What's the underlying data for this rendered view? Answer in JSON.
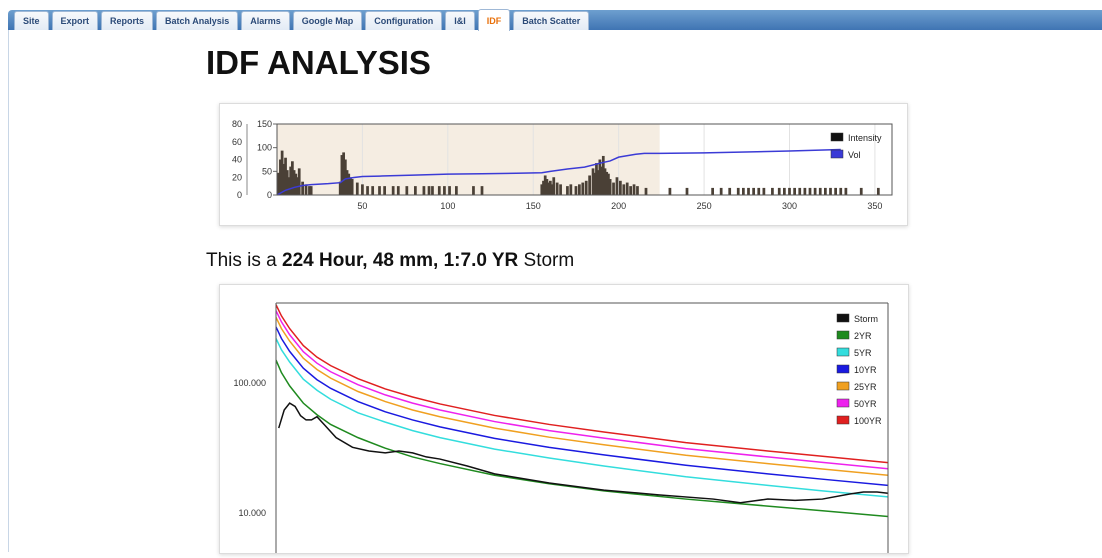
{
  "tabs": [
    {
      "label": "Site"
    },
    {
      "label": "Export"
    },
    {
      "label": "Reports"
    },
    {
      "label": "Batch Analysis"
    },
    {
      "label": "Alarms"
    },
    {
      "label": "Google Map"
    },
    {
      "label": "Configuration"
    },
    {
      "label": "I&I"
    },
    {
      "label": "IDF",
      "active": true
    },
    {
      "label": "Batch Scatter"
    }
  ],
  "page": {
    "title": "IDF ANALYSIS"
  },
  "storm": {
    "prefix": "This is a",
    "summary": "224 Hour, 48 mm, 1:7.0 YR",
    "suffix": "Storm"
  },
  "colors": {
    "tab_active": "#e8700a",
    "header_blue": "#3f74b3",
    "highlight_band": "#f5ede2",
    "bars": "#4a4036",
    "vol": "#3b3bd6"
  },
  "chart_data": [
    {
      "type": "bar",
      "x_ticks": [
        50,
        100,
        150,
        200,
        250,
        300,
        350
      ],
      "xlim": [
        0,
        360
      ],
      "left_axis_ticks": [
        0,
        20,
        40,
        60,
        80
      ],
      "left_ylim": [
        0,
        80
      ],
      "right_axis_ticks": [
        0,
        50,
        100,
        150
      ],
      "right_ylim": [
        0,
        150
      ],
      "highlight_range": [
        0,
        224
      ],
      "series": [
        {
          "name": "Intensity",
          "color": "#111111",
          "x": [
            1,
            2,
            3,
            4,
            5,
            6,
            7,
            8,
            9,
            10,
            11,
            12,
            13,
            15,
            17,
            19,
            20,
            37,
            38,
            39,
            40,
            41,
            42,
            43,
            44,
            47,
            50,
            53,
            56,
            60,
            63,
            68,
            71,
            76,
            81,
            86,
            89,
            91,
            95,
            98,
            101,
            105,
            115,
            120,
            155,
            156,
            157,
            158,
            159,
            160,
            161,
            162,
            164,
            166,
            170,
            172,
            175,
            177,
            179,
            181,
            183,
            185,
            186,
            187,
            188,
            189,
            190,
            191,
            192,
            193,
            194,
            195,
            197,
            199,
            201,
            203,
            205,
            207,
            209,
            211,
            216,
            230,
            240,
            255,
            260,
            265,
            270,
            273,
            276,
            279,
            282,
            285,
            290,
            294,
            297,
            300,
            303,
            306,
            309,
            312,
            315,
            318,
            321,
            324,
            327,
            330,
            333,
            342,
            352
          ],
          "values": [
            25,
            40,
            50,
            35,
            42,
            28,
            20,
            32,
            38,
            28,
            24,
            20,
            30,
            15,
            12,
            10,
            10,
            15,
            45,
            48,
            40,
            28,
            24,
            20,
            18,
            14,
            12,
            10,
            10,
            10,
            10,
            10,
            10,
            10,
            10,
            10,
            10,
            10,
            10,
            10,
            10,
            10,
            10,
            10,
            12,
            16,
            22,
            18,
            14,
            16,
            12,
            20,
            14,
            12,
            10,
            12,
            10,
            12,
            14,
            16,
            22,
            30,
            25,
            36,
            28,
            40,
            32,
            44,
            30,
            26,
            24,
            18,
            14,
            20,
            16,
            12,
            14,
            10,
            12,
            10,
            8,
            8,
            8,
            8,
            8,
            8,
            8,
            8,
            8,
            8,
            8,
            8,
            8,
            8,
            8,
            8,
            8,
            8,
            8,
            8,
            8,
            8,
            8,
            8,
            8,
            8,
            8,
            8,
            8
          ]
        },
        {
          "name": "Vol",
          "color": "#3b3bd6",
          "type": "line",
          "x": [
            0,
            5,
            10,
            15,
            20,
            30,
            37,
            40,
            45,
            50,
            60,
            80,
            100,
            120,
            140,
            155,
            160,
            170,
            180,
            190,
            195,
            200,
            210,
            215,
            224,
            250,
            300,
            330
          ],
          "values": [
            0,
            10,
            16,
            20,
            22,
            24,
            26,
            34,
            37,
            39,
            40,
            42,
            44,
            45,
            46,
            47,
            50,
            55,
            59,
            68,
            72,
            80,
            86,
            88,
            88,
            89,
            93,
            96
          ]
        }
      ]
    },
    {
      "type": "line",
      "yscale": "log",
      "y_ticks": [
        "100.000",
        "10.000"
      ],
      "xlim": [
        0,
        224
      ],
      "series": [
        {
          "name": "Storm",
          "color": "#111111",
          "x": [
            1,
            3,
            5,
            7,
            9,
            11,
            13,
            15,
            18,
            22,
            28,
            34,
            40,
            45,
            50,
            55,
            60,
            70,
            80,
            100,
            120,
            140,
            160,
            170,
            175,
            180,
            190,
            200,
            210,
            215,
            220,
            224
          ],
          "values": [
            45,
            62,
            70,
            66,
            56,
            52,
            52,
            55,
            47,
            38,
            32,
            30,
            29,
            30,
            29,
            27,
            26,
            23,
            20,
            17,
            15,
            13.8,
            12.8,
            12,
            12.4,
            12.8,
            12.5,
            12.8,
            14,
            14.5,
            14.5,
            14.2
          ]
        },
        {
          "name": "2YR",
          "color": "#1f8a1f",
          "x": [
            0,
            2,
            5,
            10,
            15,
            20,
            30,
            40,
            50,
            60,
            80,
            100,
            120,
            150,
            180,
            200,
            224
          ],
          "values": [
            150,
            120,
            95,
            70,
            57,
            48,
            38,
            31.5,
            27,
            24,
            19.5,
            16.8,
            14.8,
            12.8,
            11.3,
            10.4,
            9.4
          ]
        },
        {
          "name": "5YR",
          "color": "#33dddd",
          "x": [
            0,
            2,
            5,
            10,
            15,
            20,
            30,
            40,
            50,
            60,
            80,
            100,
            120,
            150,
            180,
            200,
            224
          ],
          "values": [
            220,
            180,
            145,
            107,
            88,
            75,
            59,
            50,
            43,
            38,
            31,
            26.5,
            23,
            19,
            16.3,
            14.8,
            13.3
          ]
        },
        {
          "name": "10YR",
          "color": "#1a1ae0",
          "x": [
            0,
            2,
            5,
            10,
            15,
            20,
            30,
            40,
            50,
            60,
            80,
            100,
            120,
            150,
            180,
            200,
            224
          ],
          "values": [
            270,
            220,
            175,
            130,
            106,
            91,
            72,
            60,
            52,
            46,
            37.5,
            32,
            28,
            23.3,
            20,
            18.2,
            16.3
          ]
        },
        {
          "name": "25YR",
          "color": "#f0a020",
          "x": [
            0,
            2,
            5,
            10,
            15,
            20,
            30,
            40,
            50,
            60,
            80,
            100,
            120,
            150,
            180,
            200,
            224
          ],
          "values": [
            320,
            262,
            210,
            155,
            127,
            109,
            86,
            72,
            62,
            55,
            45,
            38.3,
            33.5,
            27.8,
            24,
            21.8,
            19.5
          ]
        },
        {
          "name": "50YR",
          "color": "#ee22ee",
          "x": [
            0,
            2,
            5,
            10,
            15,
            20,
            30,
            40,
            50,
            60,
            80,
            100,
            120,
            150,
            180,
            200,
            224
          ],
          "values": [
            360,
            295,
            235,
            174,
            142,
            122,
            97,
            81,
            70,
            62,
            50.5,
            43,
            37.7,
            31.3,
            27,
            24.5,
            21.9
          ]
        },
        {
          "name": "100YR",
          "color": "#e02020",
          "x": [
            0,
            2,
            5,
            10,
            15,
            20,
            30,
            40,
            50,
            60,
            80,
            100,
            120,
            150,
            180,
            200,
            224
          ],
          "values": [
            400,
            328,
            262,
            194,
            158,
            136,
            108,
            90,
            78,
            69,
            56.3,
            48,
            42,
            34.8,
            30,
            27.3,
            24.4
          ]
        }
      ]
    }
  ]
}
